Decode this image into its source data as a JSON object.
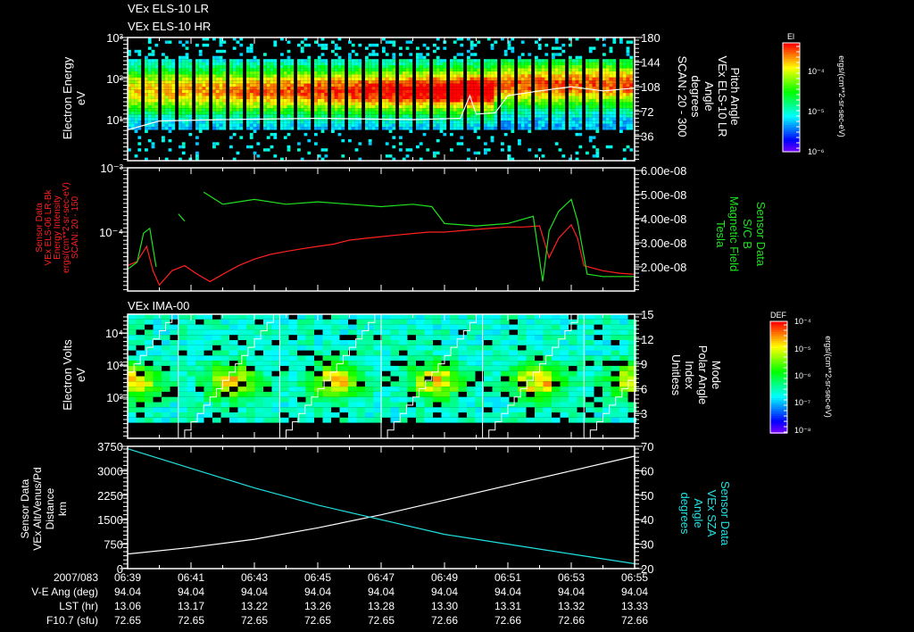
{
  "titles": {
    "els_lr": "VEx ELS-10 LR",
    "els_hr": "VEx ELS-10 HR",
    "ima": "VEx IMA-00"
  },
  "colors": {
    "background": "#000000",
    "axis": "#ffffff",
    "els_intensity": "#ff2020",
    "magnetic_field": "#20e020",
    "sza": "#20e0e0",
    "altitude": "#ffffff"
  },
  "panel1": {
    "left_label": [
      "Electron Energy",
      "eV"
    ],
    "right_label": [
      "Pitch Angle",
      "VEx ELS-10 LR",
      "Angle",
      "degrees",
      "SCAN: 20 - 300"
    ],
    "left_ticks": [
      "10³",
      "10²",
      "10¹"
    ],
    "right_ticks": [
      "180",
      "144",
      "108",
      "72",
      "36"
    ],
    "colorbar": {
      "title": "El",
      "ticks": [
        "10⁻⁴",
        "10⁻⁵",
        "10⁻⁶"
      ],
      "units": "ergs/(cm**2-sr-sec-eV)"
    }
  },
  "panel2": {
    "left_label": [
      "Sensor Data",
      "VEx ELS-06 LR-Bk",
      "Energy Intensity",
      "ergs/(cm**2-sr-sec-eV)",
      "SCAN: 20 - 150"
    ],
    "right_label": [
      "Sensor Data",
      "S/C  B",
      "Magnetic Field",
      "Tesla"
    ],
    "left_ticks": [
      "10⁻³",
      "10⁻⁴"
    ],
    "right_ticks": [
      "6.00e-08",
      "5.00e-08",
      "4.00e-08",
      "3.00e-08",
      "2.00e-08"
    ]
  },
  "panel3": {
    "left_label": [
      "Electron Volts",
      "eV"
    ],
    "right_label": [
      "Mode",
      "Polar Angle",
      "Index",
      "Unitless"
    ],
    "left_ticks": [
      "10⁴",
      "10³",
      "10²"
    ],
    "right_ticks": [
      "15",
      "12",
      "9",
      "6",
      "3"
    ],
    "colorbar": {
      "title": "DEF",
      "ticks": [
        "10⁻⁴",
        "10⁻⁵",
        "10⁻⁶",
        "10⁻⁷",
        "10⁻⁸"
      ],
      "units": "ergs/(cm**2-sr-sec-eV)"
    }
  },
  "panel4": {
    "left_label": [
      "Sensor Data",
      "VEx Alt/Venus/Pd",
      "Distance",
      "km"
    ],
    "right_label": [
      "Sensor Data",
      "VEx SZA",
      "Angle",
      "degrees"
    ],
    "left_ticks": [
      "3750",
      "3000",
      "2250",
      "1500",
      "750",
      "0"
    ],
    "right_ticks": [
      "70",
      "60",
      "50",
      "40",
      "30",
      "20"
    ]
  },
  "footer": {
    "row_labels": [
      "2007/083",
      "V-E Ang (deg)",
      "LST (hr)",
      "F10.7 (sfu)"
    ],
    "times": [
      "06:39",
      "06:41",
      "06:43",
      "06:45",
      "06:47",
      "06:49",
      "06:51",
      "06:53",
      "06:55"
    ],
    "ve_ang": [
      "94.04",
      "94.04",
      "94.04",
      "94.04",
      "94.04",
      "94.04",
      "94.04",
      "94.04",
      "94.04"
    ],
    "lst": [
      "13.06",
      "13.17",
      "13.22",
      "13.26",
      "13.28",
      "13.30",
      "13.31",
      "13.32",
      "13.33"
    ],
    "f107": [
      "72.65",
      "72.65",
      "72.65",
      "72.65",
      "72.65",
      "72.66",
      "72.66",
      "72.66",
      "72.66"
    ]
  },
  "chart_data": [
    {
      "type": "heatmap",
      "title": "VEx ELS-10 LR / VEx ELS-10 HR",
      "x_unit": "minutes after 06:39",
      "xlim": [
        0,
        16
      ],
      "ylabel": "Electron Energy (eV)",
      "ylim_log10": [
        0,
        3
      ],
      "y2label": "Pitch Angle (degrees)",
      "y2lim": [
        0,
        180
      ],
      "overlay_pitch_angle": {
        "t": [
          0,
          1,
          3,
          6,
          9,
          10.5,
          10.8,
          11,
          11.6,
          12,
          13,
          14,
          15,
          16
        ],
        "values": [
          45,
          58,
          60,
          62,
          60,
          62,
          95,
          68,
          70,
          95,
          102,
          108,
          102,
          106
        ]
      }
    },
    {
      "type": "line",
      "x_unit": "minutes after 06:39",
      "xlim": [
        0,
        16
      ],
      "series": [
        {
          "name": "ELS energy intensity (ergs/(cm**2-sr-sec-eV))",
          "axis": "left-log",
          "ylim": [
            1e-05,
            0.001
          ],
          "t": [
            0,
            0.3,
            0.6,
            0.8,
            1,
            1.4,
            1.8,
            2.2,
            2.6,
            3,
            3.5,
            4,
            4.5,
            5,
            5.5,
            6,
            6.5,
            7,
            7.5,
            8,
            8.5,
            9,
            9.5,
            10,
            10.5,
            11,
            11.5,
            12,
            12.5,
            13,
            13.3,
            13.6,
            14,
            14.2,
            14.4,
            15,
            15.5,
            16
          ],
          "values": [
            3e-05,
            3.5e-05,
            6e-05,
            2.5e-05,
            1.5e-05,
            2.5e-05,
            3e-05,
            2.2e-05,
            1.7e-05,
            2.2e-05,
            3e-05,
            3.8e-05,
            4.5e-05,
            5e-05,
            5.5e-05,
            6e-05,
            6.5e-05,
            7.5e-05,
            8e-05,
            8.5e-05,
            9e-05,
            9.5e-05,
            0.0001,
            0.0001,
            0.000105,
            0.00011,
            0.000115,
            0.00012,
            0.00012,
            0.000125,
            4e-05,
            8e-05,
            0.00013,
            8e-05,
            3e-05,
            2.5e-05,
            2.3e-05,
            2.2e-05
          ]
        },
        {
          "name": "S/C B Magnetic Field (Tesla)",
          "axis": "right",
          "ylim": [
            1e-08,
            6e-08
          ],
          "t": [
            0,
            0.3,
            0.5,
            0.7,
            0.9,
            null,
            1.6,
            1.8,
            null,
            2.4,
            3,
            4,
            5,
            6,
            7,
            8,
            9,
            9.6,
            10,
            11,
            12,
            12.8,
            13.1,
            13.3,
            13.6,
            14,
            14.2,
            14.5,
            15,
            16
          ],
          "values": [
            1.9e-08,
            2.2e-08,
            3.4e-08,
            3.6e-08,
            2e-08,
            null,
            4.2e-08,
            3.9e-08,
            null,
            5.1e-08,
            4.6e-08,
            4.8e-08,
            4.6e-08,
            4.7e-08,
            4.6e-08,
            4.5e-08,
            4.6e-08,
            4.5e-08,
            3.8e-08,
            3.7e-08,
            3.8e-08,
            4.1e-08,
            1.4e-08,
            3.5e-08,
            4.3e-08,
            4.8e-08,
            3.9e-08,
            1.7e-08,
            1.6e-08,
            1.6e-08
          ]
        }
      ]
    },
    {
      "type": "heatmap",
      "title": "VEx IMA-00",
      "x_unit": "minutes after 06:39",
      "xlim": [
        0,
        16
      ],
      "ylabel": "Electron Volts (eV)",
      "ylim_log10": [
        0.72,
        4.58
      ],
      "y2label": "Mode Polar Angle Index (Unitless)",
      "y2lim": [
        0,
        15
      ],
      "mode_cycle_boundaries_min": [
        1.6,
        4.8,
        8.0,
        11.2,
        14.4
      ]
    },
    {
      "type": "line",
      "x_unit": "minutes after 06:39",
      "xlim": [
        0,
        16
      ],
      "series": [
        {
          "name": "VEx Alt/Venus/Pd Distance (km)",
          "axis": "left",
          "ylim": [
            0,
            3750
          ],
          "t": [
            0,
            2,
            4,
            6,
            8,
            10,
            12,
            14,
            16
          ],
          "values": [
            450,
            650,
            900,
            1250,
            1650,
            2100,
            2550,
            3000,
            3450
          ]
        },
        {
          "name": "VEx SZA Angle (degrees)",
          "axis": "right",
          "ylim": [
            20,
            70
          ],
          "t": [
            0,
            2,
            4,
            6,
            8,
            10,
            12,
            14,
            16
          ],
          "values": [
            69,
            61,
            53,
            46,
            40,
            34,
            30,
            26,
            22
          ]
        }
      ]
    }
  ]
}
